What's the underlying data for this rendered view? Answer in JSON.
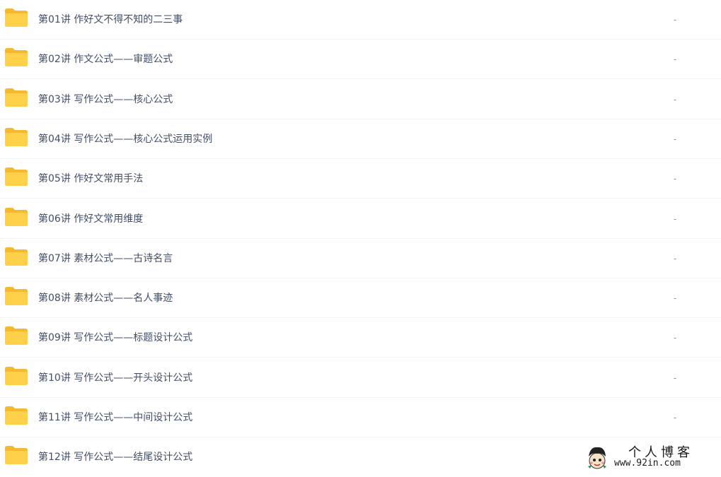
{
  "file_list": {
    "items": [
      {
        "name": "第01讲 作好文不得不知的二三事",
        "size": "-"
      },
      {
        "name": "第02讲 作文公式——审题公式",
        "size": "-"
      },
      {
        "name": "第03讲 写作公式——核心公式",
        "size": "-"
      },
      {
        "name": "第04讲 写作公式——核心公式运用实例",
        "size": "-"
      },
      {
        "name": "第05讲 作好文常用手法",
        "size": "-"
      },
      {
        "name": "第06讲 作好文常用维度",
        "size": "-"
      },
      {
        "name": "第07讲 素材公式——古诗名言",
        "size": "-"
      },
      {
        "name": "第08讲 素材公式——名人事迹",
        "size": "-"
      },
      {
        "name": "第09讲 写作公式——标题设计公式",
        "size": "-"
      },
      {
        "name": "第10讲 写作公式——开头设计公式",
        "size": "-"
      },
      {
        "name": "第11讲 写作公式——中间设计公式",
        "size": "-"
      },
      {
        "name": "第12讲 写作公式——结尾设计公式",
        "size": ""
      }
    ],
    "icon": "folder-icon",
    "folder_color": "#ffd04a"
  },
  "watermark": {
    "title": "个人博客",
    "url": "www.92in.com"
  }
}
